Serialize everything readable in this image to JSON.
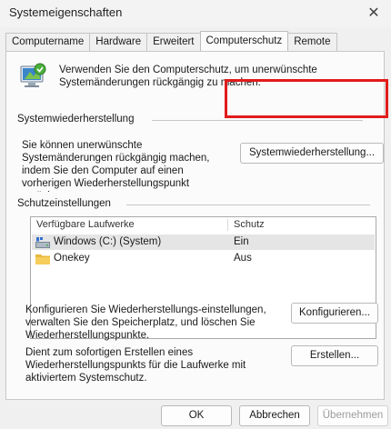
{
  "window": {
    "title": "Systemeigenschaften"
  },
  "tabs": [
    {
      "label": "Computername",
      "active": false
    },
    {
      "label": "Hardware",
      "active": false
    },
    {
      "label": "Erweitert",
      "active": false
    },
    {
      "label": "Computerschutz",
      "active": true
    },
    {
      "label": "Remote",
      "active": false
    }
  ],
  "intro": {
    "icon": "system-protection-icon",
    "text": "Verwenden Sie den Computerschutz, um unerwünschte Systemänderungen rückgängig zu machen."
  },
  "restore": {
    "group_label": "Systemwiederherstellung",
    "text": "Sie können unerwünschte Systemänderungen rückgängig machen, indem Sie den Computer auf einen vorherigen Wiederherstellungspunkt zurücksetzen.",
    "button_label": "Systemwiederherstellung...",
    "highlight_color": "#e21b1b"
  },
  "protection": {
    "group_label": "Schutzeinstellungen",
    "columns": [
      "Verfügbare Laufwerke",
      "Schutz"
    ],
    "drives": [
      {
        "name": "Windows (C:) (System)",
        "protection": "Ein",
        "icon": "system-drive-icon",
        "selected": true
      },
      {
        "name": "Onekey",
        "protection": "Aus",
        "icon": "folder-icon",
        "selected": false
      }
    ],
    "configure_text": "Konfigurieren Sie Wiederherstellungs-einstellungen, verwalten Sie den Speicherplatz, und löschen Sie Wiederherstellungspunkte.",
    "configure_button": "Konfigurieren...",
    "create_text": "Dient zum sofortigen Erstellen eines Wiederherstellungspunkts für die Laufwerke mit aktiviertem Systemschutz.",
    "create_button": "Erstellen..."
  },
  "footer": {
    "ok": "OK",
    "cancel": "Abbrechen",
    "apply": "Übernehmen"
  }
}
